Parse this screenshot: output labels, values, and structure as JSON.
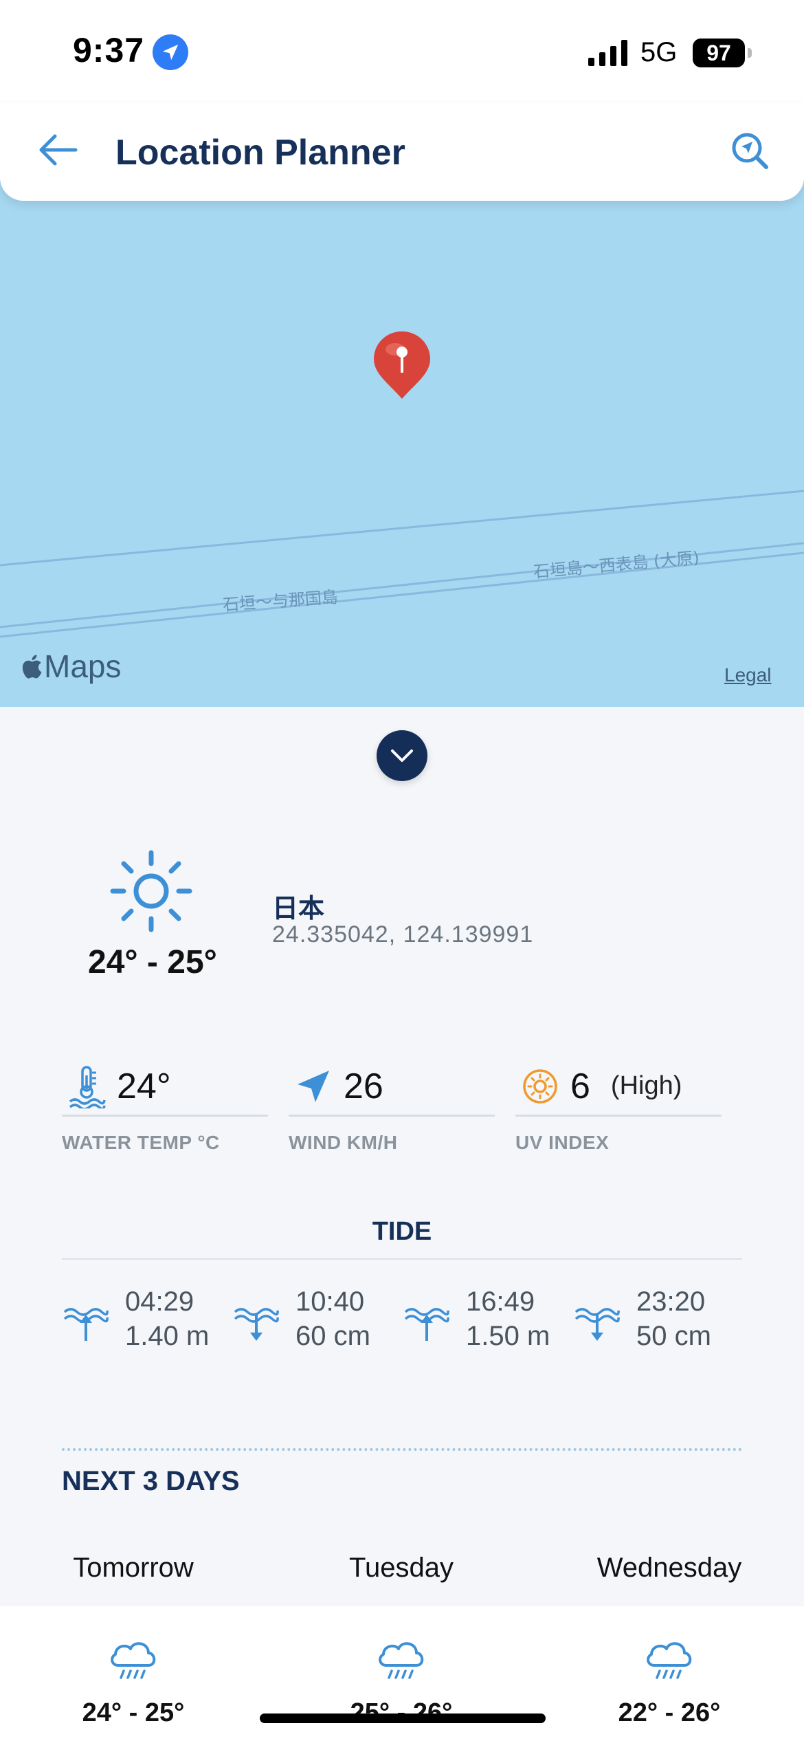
{
  "status_bar": {
    "time": "9:37",
    "network": "5G",
    "battery": "97"
  },
  "header": {
    "title": "Location Planner"
  },
  "map": {
    "route_label_1": "石垣～与那国島",
    "route_label_2": "石垣島～西表島 (大原)",
    "brand": "Maps",
    "legal": "Legal"
  },
  "summary": {
    "temp_range": "24° - 25°",
    "place_name": "日本",
    "coordinates": "24.335042, 124.139991"
  },
  "metrics": {
    "water_temp": {
      "value": "24°",
      "label": "WATER TEMP °C"
    },
    "wind": {
      "value": "26",
      "label": "WIND KM/H"
    },
    "uv": {
      "value": "6",
      "level": "(High)",
      "label": "UV INDEX"
    }
  },
  "tide": {
    "title": "TIDE",
    "entries": [
      {
        "time": "04:29",
        "height": "1.40 m",
        "direction": "high"
      },
      {
        "time": "10:40",
        "height": "60 cm",
        "direction": "low"
      },
      {
        "time": "16:49",
        "height": "1.50 m",
        "direction": "high"
      },
      {
        "time": "23:20",
        "height": "50 cm",
        "direction": "low"
      }
    ]
  },
  "next_days": {
    "title": "NEXT 3 DAYS",
    "days": [
      {
        "name": "Tomorrow",
        "temp_range": "24° - 25°",
        "icon": "rain-cloud-icon"
      },
      {
        "name": "Tuesday",
        "temp_range": "25° - 26°",
        "icon": "rain-cloud-icon"
      },
      {
        "name": "Wednesday",
        "temp_range": "22° - 26°",
        "icon": "rain-cloud-icon"
      }
    ]
  },
  "colors": {
    "accent": "#3d8fd6",
    "title_navy": "#17305a",
    "map_water": "#a6d8f2",
    "uv_orange": "#f0992e",
    "pin_red": "#d9443a"
  }
}
